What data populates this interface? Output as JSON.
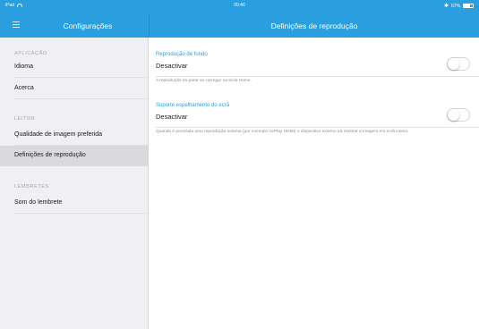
{
  "status_bar": {
    "device": "iPad",
    "time": "00:40",
    "battery_text": "67%",
    "battery_level": 0.67,
    "bluetooth_symbol": "✱",
    "wifi_icon": "wifi-icon"
  },
  "nav": {
    "left_title": "Configurações",
    "right_title": "Definições de reprodução",
    "menu_icon": "hamburger-menu-icon"
  },
  "sidebar": {
    "sections": [
      {
        "header": "APLICAÇÃO",
        "items": [
          {
            "label": "Idioma"
          },
          {
            "label": "Acerca"
          }
        ]
      },
      {
        "header": "LEITOR",
        "items": [
          {
            "label": "Qualidade de imagem preferida"
          },
          {
            "label": "Definições de reprodução",
            "selected": true
          }
        ]
      },
      {
        "header": "LEMBRETES",
        "items": [
          {
            "label": "Som do lembrete"
          }
        ]
      }
    ]
  },
  "settings": [
    {
      "title": "Reprodução de fundo",
      "value": "Desactivar",
      "toggle_on": false,
      "description": "A reprodução irá parar se carregar na tecla Home."
    },
    {
      "title": "Suporte espelhamento do ecrã",
      "value": "Desactivar",
      "toggle_on": false,
      "description": "Quando é permitida uma reprodução externa (por exemplo AirPlay HDMI) o dispositivo externo irá mostrar a imagem em ecrã inteiro."
    }
  ],
  "colors": {
    "accent": "#2a9fe0",
    "sidebar_bg": "#efeff4",
    "selected_row": "#d9d9de"
  }
}
